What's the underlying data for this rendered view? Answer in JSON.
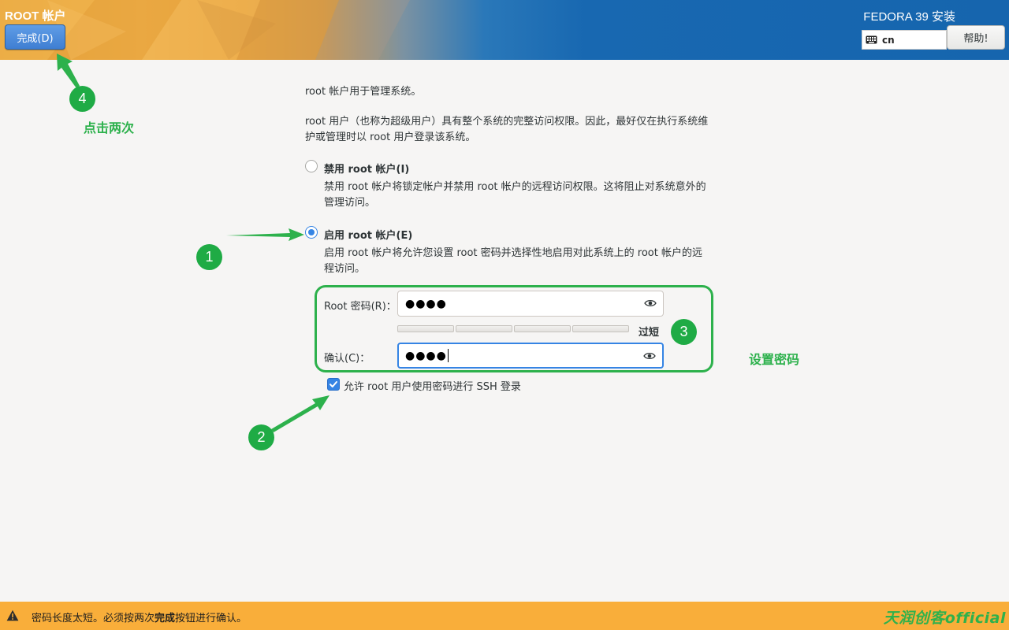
{
  "header": {
    "title": "ROOT 帐户",
    "done_button": "完成(D)",
    "product": "FEDORA 39 安装",
    "keyboard_layout": "cn",
    "help_button": "帮助!"
  },
  "content": {
    "intro_line1": "root 帐户用于管理系统。",
    "intro_line2": "root 用户（也称为超级用户）具有整个系统的完整访问权限。因此，最好仅在执行系统维护或管理时以 root 用户登录该系统。",
    "disable_option": {
      "label": "禁用 root 帐户(I)",
      "description": "禁用 root 帐户将锁定帐户并禁用 root 帐户的远程访问权限。这将阻止对系统意外的管理访问。",
      "selected": false
    },
    "enable_option": {
      "label": "启用 root 帐户(E)",
      "description": "启用 root 帐户将允许您设置 root 密码并选择性地启用对此系统上的 root 帐户的远程访问。",
      "selected": true
    },
    "password_field": {
      "label": "Root 密码(R)：",
      "value": "●●●●"
    },
    "strength": {
      "text": "过短",
      "level": 0
    },
    "confirm_field": {
      "label": "确认(C)：",
      "value": "●●●●"
    },
    "ssh_checkbox": {
      "label": "允许 root 用户使用密码进行 SSH 登录",
      "checked": true
    }
  },
  "annotations": {
    "step1": "1",
    "step2": "2",
    "step3": "3",
    "step4": "4",
    "click_twice": "点击两次",
    "set_password": "设置密码"
  },
  "warning": {
    "text_before": "密码长度太短。必须按两次",
    "text_bold": "完成",
    "text_after": "按钮进行确认。",
    "watermark": "天润创客official"
  },
  "colors": {
    "accent": "#3584e4",
    "annotation_green": "#2db14c",
    "warning_bar": "#f9ae3a",
    "header_blue": "#1665ae",
    "header_orange": "#e9a53f"
  }
}
